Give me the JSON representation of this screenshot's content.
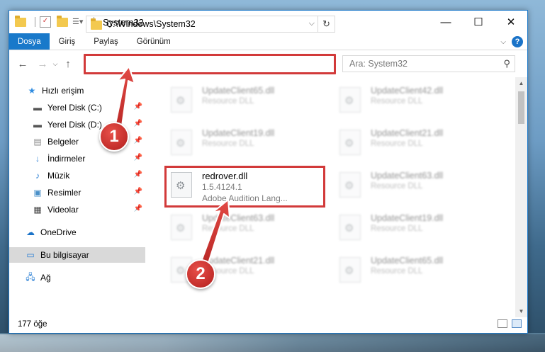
{
  "window": {
    "title": "System32",
    "controls": {
      "minimize": "—",
      "maximize": "☐",
      "close": "✕"
    }
  },
  "ribbon": {
    "tabs": [
      {
        "label": "Dosya",
        "active": true
      },
      {
        "label": "Giriş"
      },
      {
        "label": "Paylaş"
      },
      {
        "label": "Görünüm"
      }
    ],
    "expand_icon": "chevron-down-icon",
    "help": "?"
  },
  "address": {
    "path": "C:\\Windows\\System32",
    "search_placeholder": "Ara: System32"
  },
  "sidebar": {
    "items": [
      {
        "label": "Hızlı erişim",
        "icon": "star-icon",
        "pinned": false
      },
      {
        "label": "Yerel Disk (C:)",
        "icon": "drive-icon",
        "pinned": true
      },
      {
        "label": "Yerel Disk (D:)",
        "icon": "drive-icon",
        "pinned": true
      },
      {
        "label": "Belgeler",
        "icon": "documents-icon",
        "pinned": true
      },
      {
        "label": "İndirmeler",
        "icon": "download-icon",
        "pinned": true
      },
      {
        "label": "Müzik",
        "icon": "music-icon",
        "pinned": true
      },
      {
        "label": "Resimler",
        "icon": "pictures-icon",
        "pinned": true
      },
      {
        "label": "Videolar",
        "icon": "videos-icon",
        "pinned": true
      },
      {
        "label": "OneDrive",
        "icon": "cloud-icon",
        "pinned": false
      },
      {
        "label": "Bu bilgisayar",
        "icon": "computer-icon",
        "pinned": false,
        "selected": true
      },
      {
        "label": "Ağ",
        "icon": "network-icon",
        "pinned": false
      }
    ]
  },
  "files": {
    "left": [
      {
        "name": "UpdateClient65.dll",
        "type": "Resource DLL"
      },
      {
        "name": "UpdateClient19.dll",
        "type": "Resource DLL"
      },
      {
        "name": "redrover.dll",
        "version": "1.5.4124.1",
        "description": "Adobe Audition Lang...",
        "focused": true
      },
      {
        "name": "UpdateClient63.dll",
        "type": "Resource DLL"
      },
      {
        "name": "UpdateClient21.dll",
        "type": "Resource DLL"
      }
    ],
    "right": [
      {
        "name": "UpdateClient42.dll",
        "type": "Resource DLL"
      },
      {
        "name": "UpdateClient21.dll",
        "type": "Resource DLL"
      },
      {
        "name": "UpdateClient63.dll",
        "type": "Resource DLL"
      },
      {
        "name": "UpdateClient19.dll",
        "type": "Resource DLL"
      },
      {
        "name": "UpdateClient65.dll",
        "type": "Resource DLL"
      }
    ]
  },
  "status": {
    "count": "177 öğe"
  },
  "annotations": {
    "step1": "1",
    "step2": "2",
    "color": "#d23a3a"
  }
}
